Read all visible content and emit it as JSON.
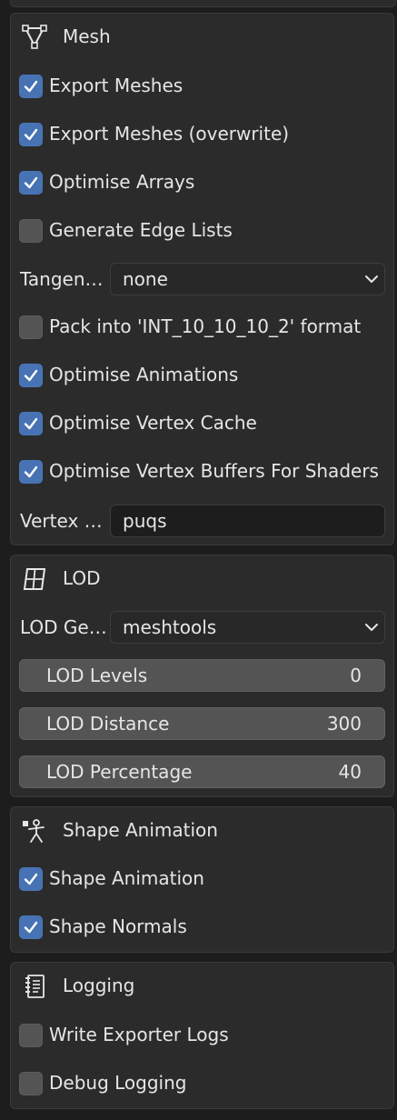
{
  "mesh": {
    "title": "Mesh",
    "icon": "mesh-triangle-icon",
    "export_meshes": {
      "label": "Export Meshes",
      "checked": true
    },
    "export_meshes_overwrite": {
      "label": "Export Meshes (overwrite)",
      "checked": true
    },
    "optimise_arrays": {
      "label": "Optimise Arrays",
      "checked": true
    },
    "generate_edge_lists": {
      "label": "Generate Edge Lists",
      "checked": false
    },
    "tangents": {
      "label": "Tangen…",
      "value": "none"
    },
    "pack_format": {
      "label": "Pack into 'INT_10_10_10_2' format",
      "checked": false
    },
    "optimise_animations": {
      "label": "Optimise Animations",
      "checked": true
    },
    "optimise_vertex_cache": {
      "label": "Optimise Vertex Cache",
      "checked": true
    },
    "optimise_vertex_buffers": {
      "label": "Optimise Vertex Buffers For Shaders",
      "checked": true
    },
    "vertex_field": {
      "label": "Vertex …",
      "value": "puqs"
    }
  },
  "lod": {
    "title": "LOD",
    "icon": "lod-grid-icon",
    "generator": {
      "label": "LOD Ge…",
      "value": "meshtools"
    },
    "levels": {
      "label": "LOD Levels",
      "value": "0"
    },
    "distance": {
      "label": "LOD Distance",
      "value": "300"
    },
    "percentage": {
      "label": "LOD Percentage",
      "value": "40"
    }
  },
  "shape_animation": {
    "title": "Shape Animation",
    "icon": "shape-key-icon",
    "shape_animation": {
      "label": "Shape Animation",
      "checked": true
    },
    "shape_normals": {
      "label": "Shape Normals",
      "checked": true
    }
  },
  "logging": {
    "title": "Logging",
    "icon": "log-text-icon",
    "write_exporter_logs": {
      "label": "Write Exporter Logs",
      "checked": false
    },
    "debug_logging": {
      "label": "Debug Logging",
      "checked": false
    }
  },
  "colors": {
    "panel_bg": "#2b2b2b",
    "checkbox_on": "#4772b3",
    "checkbox_off": "#545454"
  }
}
